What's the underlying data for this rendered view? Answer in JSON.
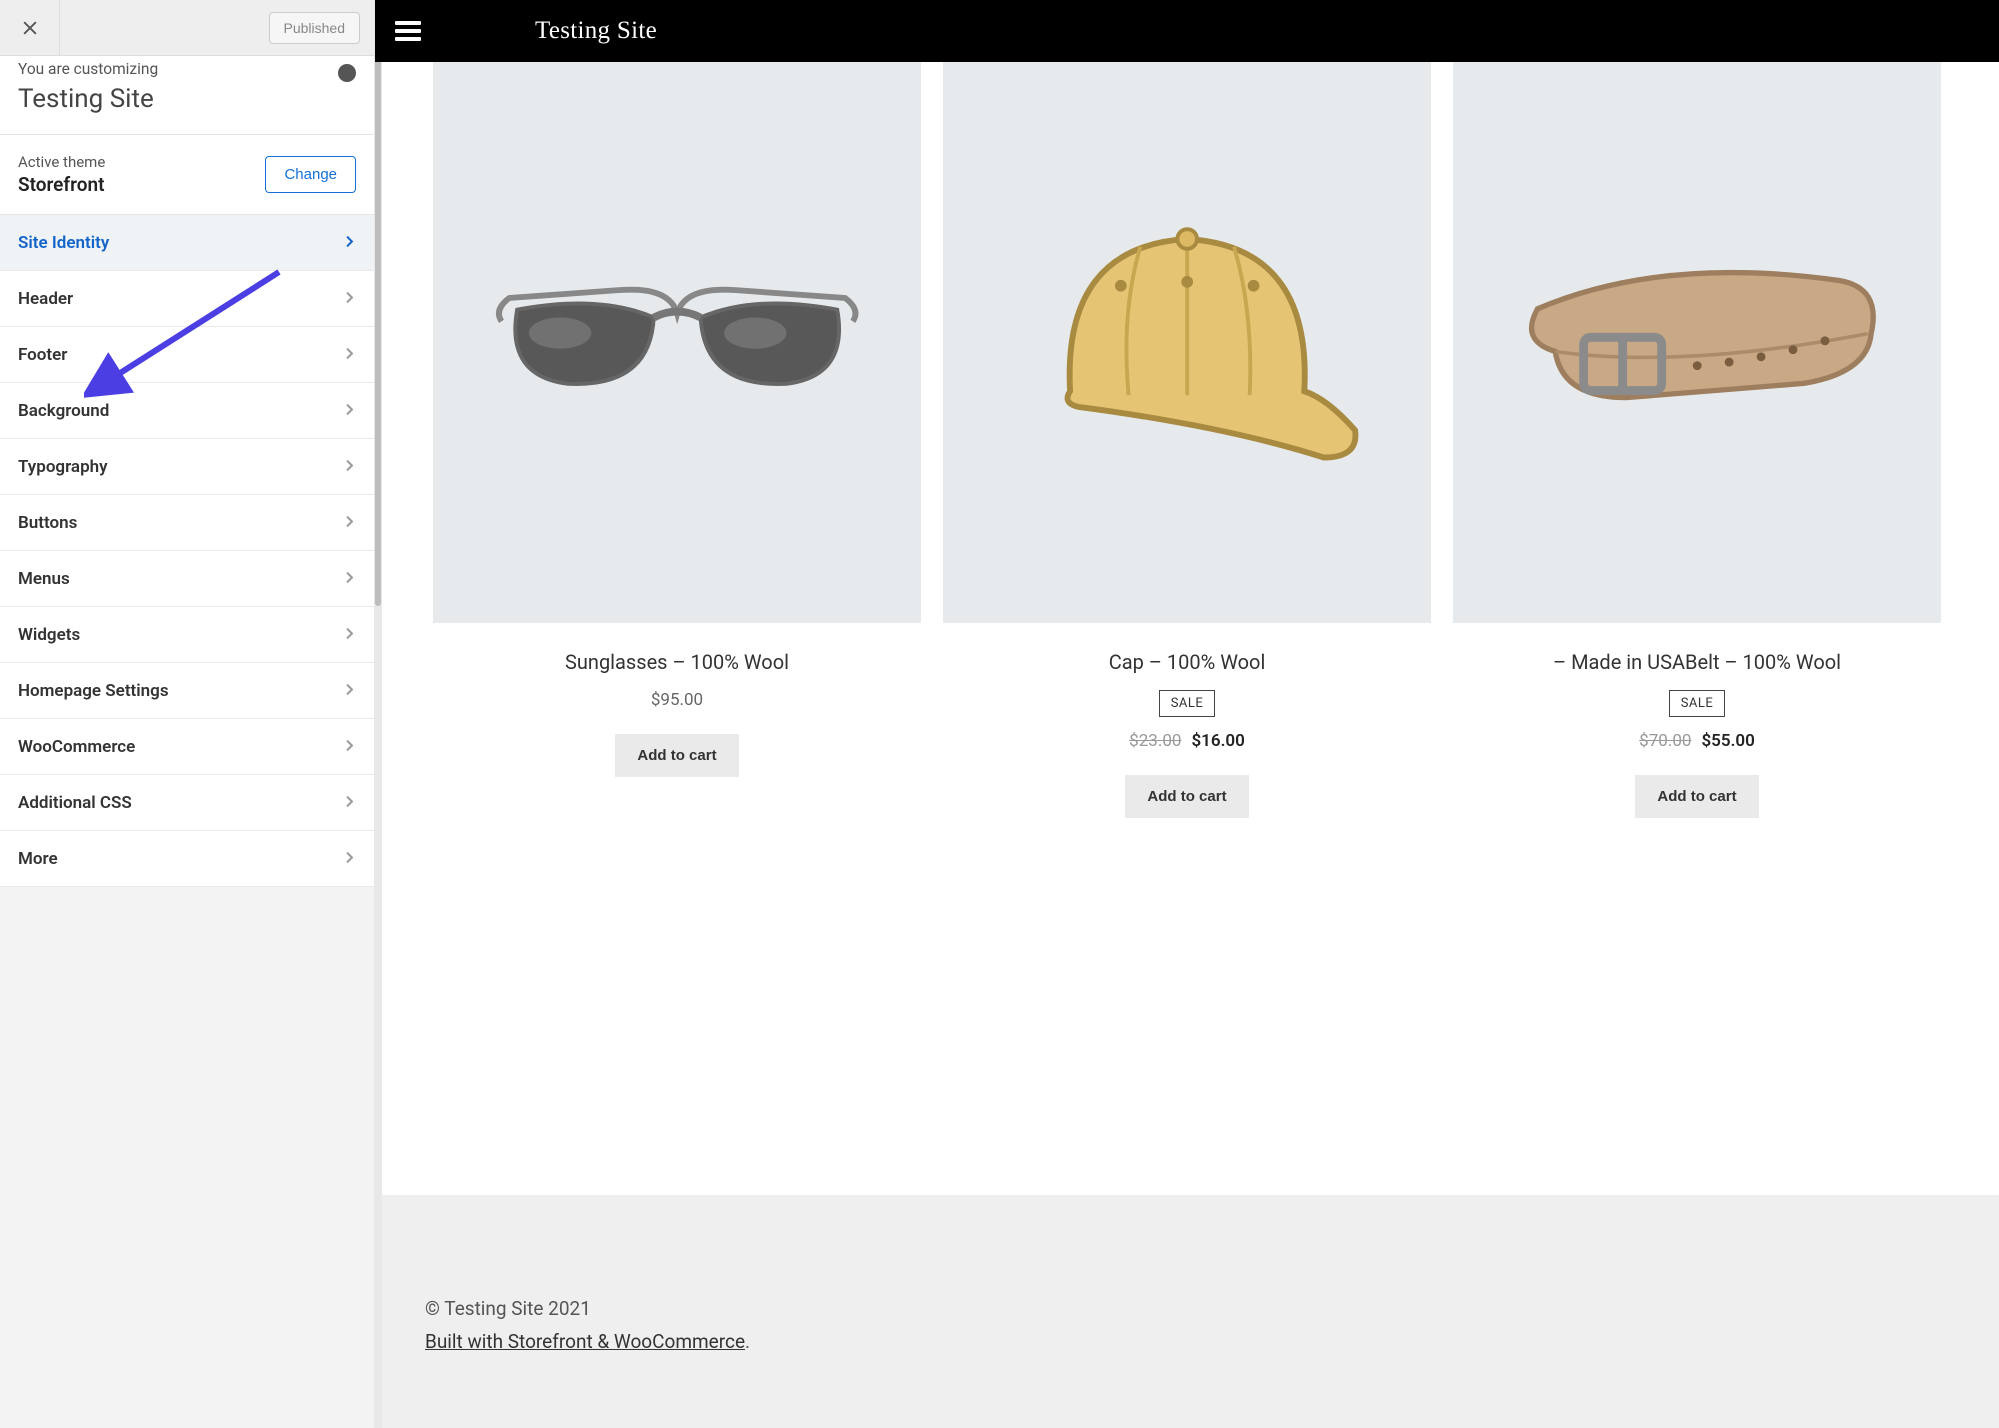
{
  "topbar": {
    "published_label": "Published"
  },
  "context": {
    "you_are_customizing": "You are customizing",
    "site_name": "Testing Site"
  },
  "theme": {
    "active_theme_label": "Active theme",
    "theme_name": "Storefront",
    "change_label": "Change"
  },
  "panels": [
    {
      "label": "Site Identity",
      "active": true
    },
    {
      "label": "Header",
      "active": false
    },
    {
      "label": "Footer",
      "active": false
    },
    {
      "label": "Background",
      "active": false
    },
    {
      "label": "Typography",
      "active": false
    },
    {
      "label": "Buttons",
      "active": false
    },
    {
      "label": "Menus",
      "active": false
    },
    {
      "label": "Widgets",
      "active": false
    },
    {
      "label": "Homepage Settings",
      "active": false
    },
    {
      "label": "WooCommerce",
      "active": false
    },
    {
      "label": "Additional CSS",
      "active": false
    },
    {
      "label": "More",
      "active": false
    }
  ],
  "preview": {
    "header": {
      "site_title": "Testing Site"
    },
    "products": [
      {
        "icon": "sunglasses",
        "title": "Sunglasses – 100% Wool",
        "sale": false,
        "old_price": "",
        "price": "$95.00",
        "button": "Add to cart"
      },
      {
        "icon": "cap",
        "title": "Cap – 100% Wool",
        "sale": true,
        "sale_label": "SALE",
        "old_price": "$23.00",
        "price": "$16.00",
        "button": "Add to cart"
      },
      {
        "icon": "belt",
        "title": "– Made in USABelt – 100% Wool",
        "sale": true,
        "sale_label": "SALE",
        "old_price": "$70.00",
        "price": "$55.00",
        "button": "Add to cart"
      }
    ],
    "footer": {
      "copyright": "© Testing Site 2021",
      "built_with": "Built with Storefront & WooCommerce",
      "period": "."
    }
  },
  "annotation": {
    "arrow_color": "#4b3fe4"
  }
}
